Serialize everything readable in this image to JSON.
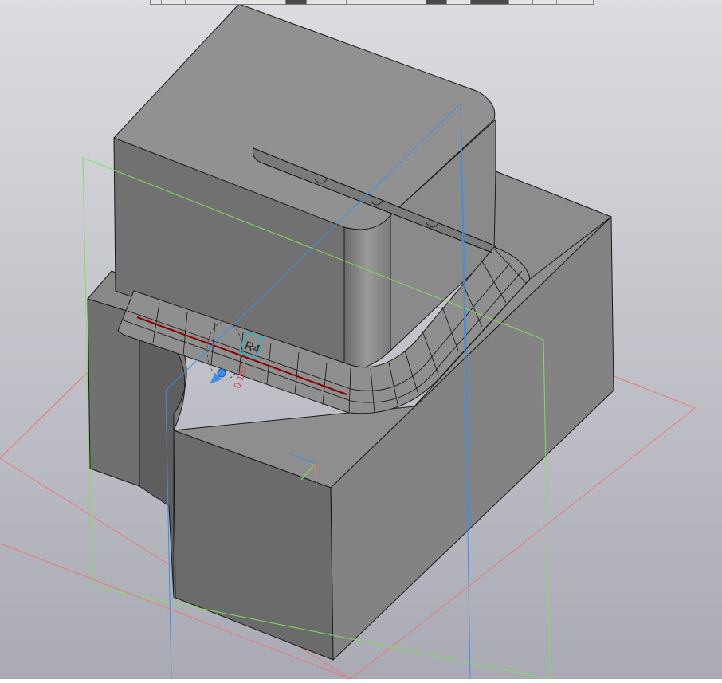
{
  "viewport": {
    "background_top": "#dcdde0",
    "background_bottom": "#a9aab4"
  },
  "colors": {
    "face_top": "#8f8f8f",
    "face_left": "#6e6e6e",
    "face_right": "#828282",
    "face_dark": "#5a5a5a",
    "edge": "#1a1a1a",
    "plane_green": "#7fe05a",
    "plane_red": "#e87878",
    "plane_blue": "#3d8ee8",
    "highlight_edge": "#8a0000",
    "fillet_label": "#25b6c8",
    "dimension_red": "#e04040"
  },
  "annotations": {
    "fillet_radius_label": "R4",
    "dimension_value": "0.187"
  },
  "toolbar": {
    "segments": 12
  }
}
